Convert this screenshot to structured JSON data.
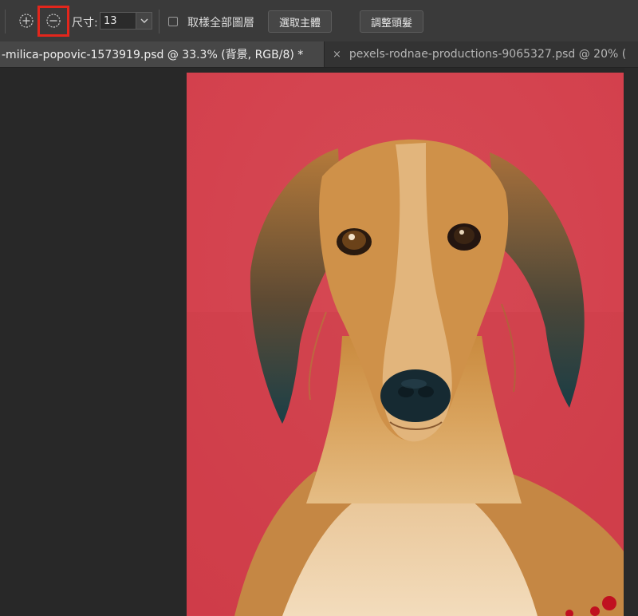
{
  "options_bar": {
    "size_label": "尺寸:",
    "size_value": "13",
    "sample_all_layers_label": "取樣全部圖層",
    "sample_all_layers_checked": false,
    "select_subject_label": "選取主體",
    "refine_hair_label": "調整頭髮",
    "add_mode_icon": "circle-plus-icon",
    "subtract_mode_icon": "circle-minus-icon",
    "highlight_color": "#e3261c"
  },
  "tabs": [
    {
      "title": "-milica-popovic-1573919.psd @ 33.3% (背景, RGB/8) *",
      "active": true
    },
    {
      "close_glyph": "×",
      "title": "pexels-rodnae-productions-9065327.psd @ 20% (",
      "active": false
    }
  ],
  "canvas": {
    "background_color": "#d9444e",
    "subject": "saluki-dog-photo"
  }
}
